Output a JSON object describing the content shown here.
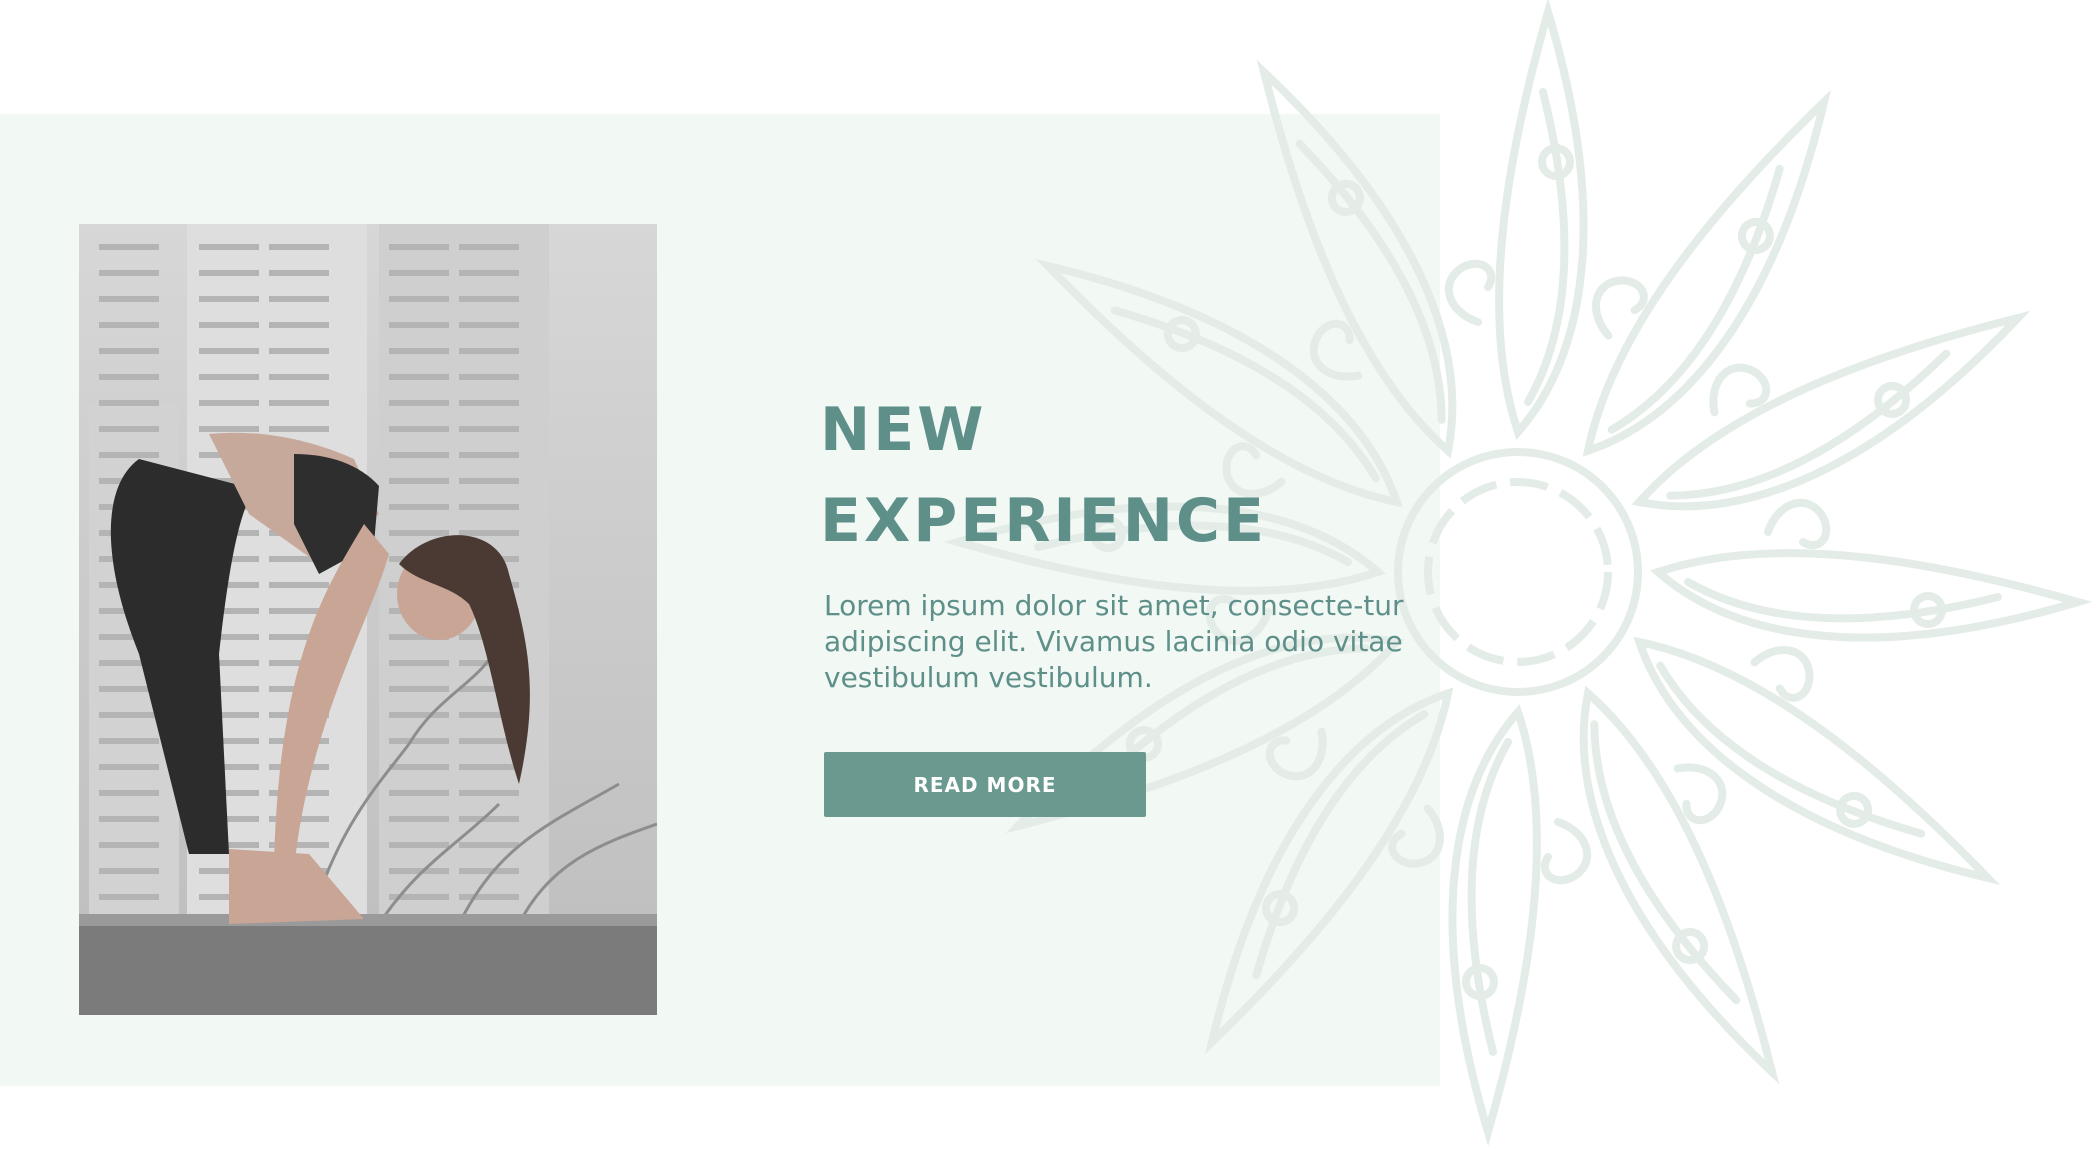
{
  "hero": {
    "title_line1": "NEW",
    "title_line2": "EXPERIENCE",
    "description": "Lorem ipsum dolor sit amet, consecte-tur adipiscing elit. Vivamus lacinia odio vitae vestibulum vestibulum.",
    "button_label": "READ MORE"
  },
  "theme": {
    "accent": "#5e8f89",
    "button_bg": "#69998f",
    "band_bg": "#f2f8f4",
    "mandala_stroke": "#e4ece8"
  },
  "images": {
    "photo": "woman-stretching-yoga-photo",
    "decoration": "mandala-flower-ornament"
  }
}
